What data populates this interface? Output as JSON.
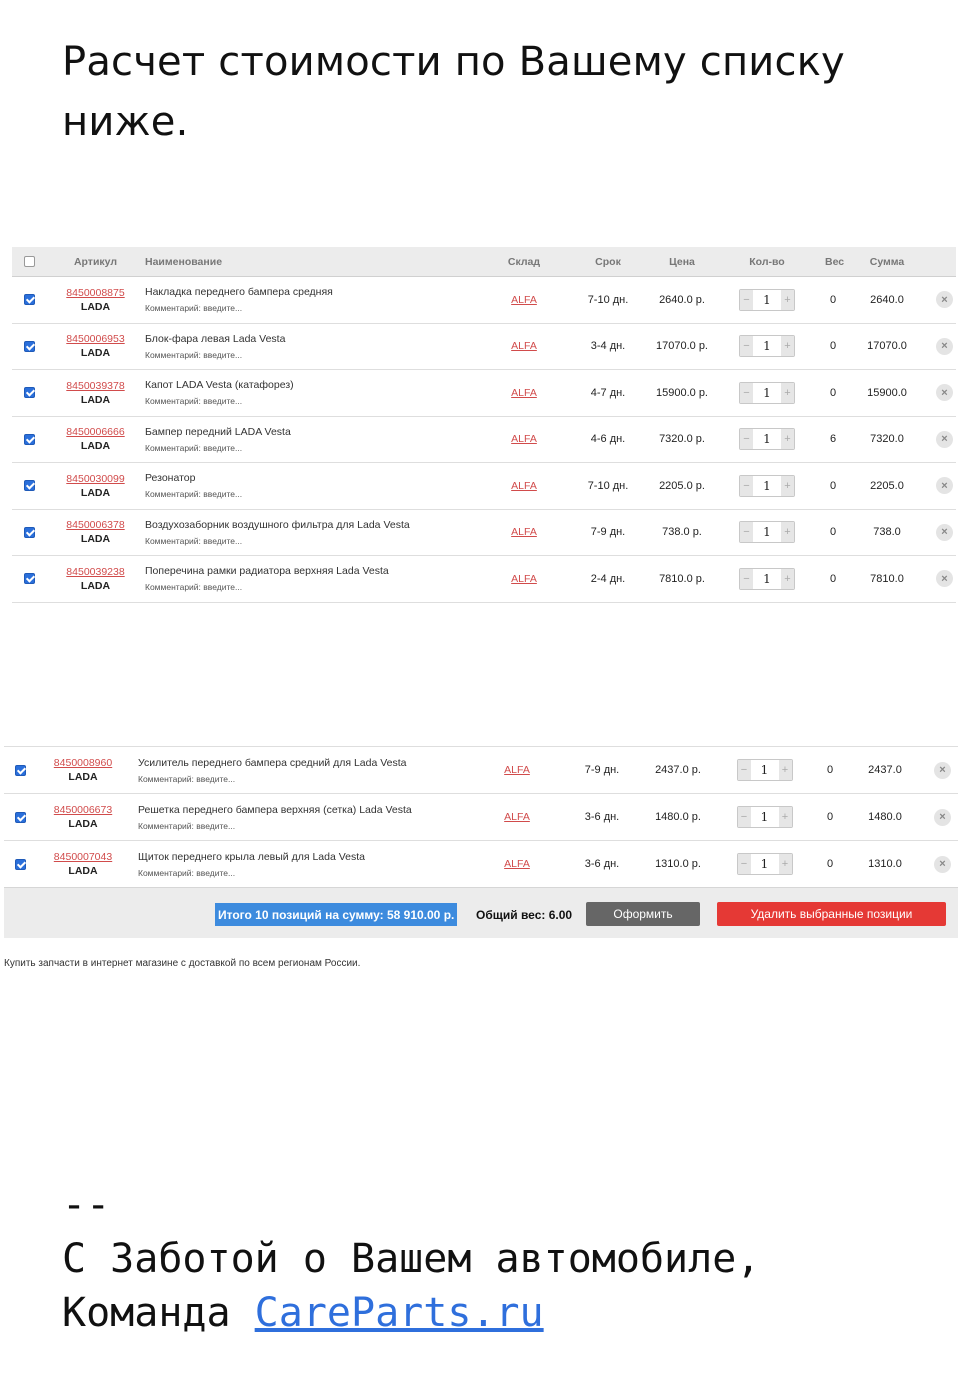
{
  "intro_text": "Расчет стоимости по Вашему списку ниже.",
  "table_headers": {
    "article": "Артикул",
    "name": "Наименование",
    "warehouse": "Склад",
    "term": "Срок",
    "price": "Цена",
    "qty": "Кол-во",
    "weight": "Вес",
    "sum": "Сумма"
  },
  "qty_minus": "−",
  "qty_plus": "+",
  "delete_glyph": "×",
  "items_group1": [
    {
      "article": "8450008875",
      "brand": "LADA",
      "name": "Накладка переднего бампера средняя",
      "comment": "Комментарий: введите...",
      "warehouse": "ALFA",
      "term": "7-10 дн.",
      "price": "2640.0 р.",
      "qty": "1",
      "weight": "0",
      "sum": "2640.0"
    },
    {
      "article": "8450006953",
      "brand": "LADA",
      "name": "Блок-фара левая Lada Vesta",
      "comment": "Комментарий: введите...",
      "warehouse": "ALFA",
      "term": "3-4 дн.",
      "price": "17070.0 р.",
      "qty": "1",
      "weight": "0",
      "sum": "17070.0"
    },
    {
      "article": "8450039378",
      "brand": "LADA",
      "name": "Капот LADA Vesta (катафорез)",
      "comment": "Комментарий: введите...",
      "warehouse": "ALFA",
      "term": "4-7 дн.",
      "price": "15900.0 р.",
      "qty": "1",
      "weight": "0",
      "sum": "15900.0"
    },
    {
      "article": "8450006666",
      "brand": "LADA",
      "name": "Бампер передний LADA Vesta",
      "comment": "Комментарий: введите...",
      "warehouse": "ALFA",
      "term": "4-6 дн.",
      "price": "7320.0 р.",
      "qty": "1",
      "weight": "6",
      "sum": "7320.0"
    },
    {
      "article": "8450030099",
      "brand": "LADA",
      "name": "Резонатор",
      "comment": "Комментарий: введите...",
      "warehouse": "ALFA",
      "term": "7-10 дн.",
      "price": "2205.0 р.",
      "qty": "1",
      "weight": "0",
      "sum": "2205.0"
    },
    {
      "article": "8450006378",
      "brand": "LADA",
      "name": "Воздухозаборник воздушного фильтра для Lada Vesta",
      "comment": "Комментарий: введите...",
      "warehouse": "ALFA",
      "term": "7-9 дн.",
      "price": "738.0 р.",
      "qty": "1",
      "weight": "0",
      "sum": "738.0"
    },
    {
      "article": "8450039238",
      "brand": "LADA",
      "name": "Поперечина рамки радиатора верхняя Lada Vesta",
      "comment": "Комментарий: введите...",
      "warehouse": "ALFA",
      "term": "2-4 дн.",
      "price": "7810.0 р.",
      "qty": "1",
      "weight": "0",
      "sum": "7810.0"
    }
  ],
  "items_group2": [
    {
      "article": "8450008960",
      "brand": "LADA",
      "name": "Усилитель переднего бампера средний для Lada Vesta",
      "comment": "Комментарий: введите...",
      "warehouse": "ALFA",
      "term": "7-9 дн.",
      "price": "2437.0 р.",
      "qty": "1",
      "weight": "0",
      "sum": "2437.0"
    },
    {
      "article": "8450006673",
      "brand": "LADA",
      "name": "Решетка переднего бампера верхняя (сетка) Lada Vesta",
      "comment": "Комментарий: введите...",
      "warehouse": "ALFA",
      "term": "3-6 дн.",
      "price": "1480.0 р.",
      "qty": "1",
      "weight": "0",
      "sum": "1480.0"
    },
    {
      "article": "8450007043",
      "brand": "LADA",
      "name": "Щиток переднего крыла левый для Lada Vesta",
      "comment": "Комментарий: введите...",
      "warehouse": "ALFA",
      "term": "3-6 дн.",
      "price": "1310.0 р.",
      "qty": "1",
      "weight": "0",
      "sum": "1310.0"
    }
  ],
  "summary": {
    "total_text": "Итого 10 позиций на сумму: 58 910.00 р.",
    "weight_text": "Общий вес: 6.00",
    "order_button": "Оформить",
    "delete_button": "Удалить выбранные позиции"
  },
  "footnote": "Купить запчасти в интернет магазине с доставкой по всем регионам России.",
  "signature": {
    "dashes": "--",
    "line1": "С Заботой о Вашем автомобиле,",
    "line2_prefix": "Команда ",
    "link_text": "CareParts.ru"
  },
  "colors": {
    "link_red": "#d14b4b",
    "highlight_blue": "#3d8bde",
    "delete_button_red": "#e53935",
    "order_button_gray": "#666666",
    "signature_link_blue": "#2f6fdc"
  }
}
